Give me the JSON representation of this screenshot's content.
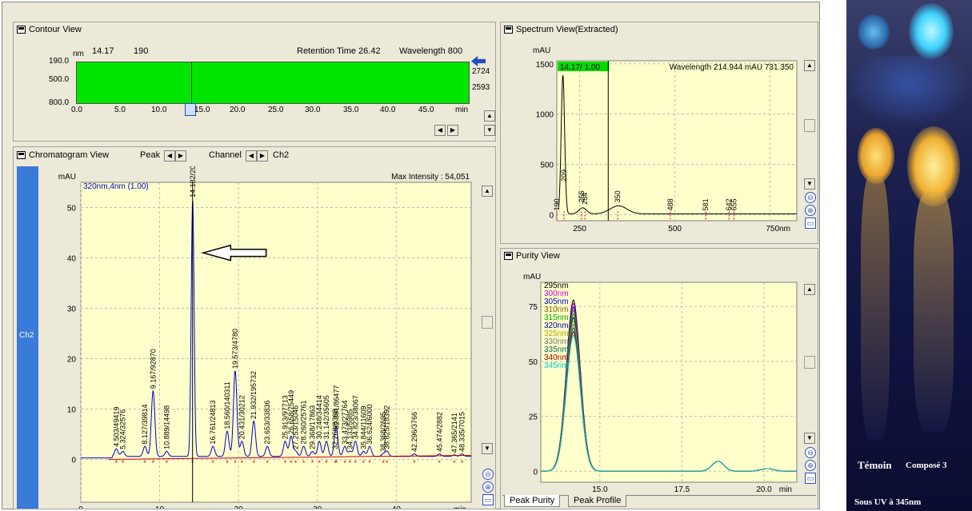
{
  "contour": {
    "title": "Contour View",
    "unit": "nm",
    "cursor_rt": "14.17",
    "cursor_wl": "190",
    "rt_label": "Retention Time 26.42",
    "wl_label": "Wavelength  800",
    "y_ticks": [
      "190.0",
      "500.0",
      "800.0"
    ],
    "x_ticks": [
      "0.0",
      "5.0",
      "10.0",
      "15.0",
      "20.0",
      "25.0",
      "30.0",
      "35.0",
      "40.0",
      "45.0"
    ],
    "x_unit": "min",
    "right_vals": [
      "2724",
      "2593"
    ]
  },
  "chromatogram": {
    "title": "Chromatogram View",
    "peak_label": "Peak",
    "channel_label": "Channel",
    "channel_value": "Ch2",
    "side_label": "Ch2",
    "y_unit": "mAU",
    "trace_label": "320nm,4nm (1.00)",
    "max_intensity": "Max Intensity : 54,051",
    "y_ticks": [
      "50",
      "40",
      "30",
      "20",
      "10",
      "0"
    ],
    "x_ticks": [
      "0",
      "10",
      "20",
      "30",
      "40"
    ],
    "x_unit": "min",
    "peak_labels": [
      "4.503/49419",
      "5.324/32576",
      "8.127/39814",
      "9.167/92870",
      "10.889/14498",
      "14.182/2050641",
      "16.761/24813",
      "18.560/140311",
      "19.573/4780",
      "20.431/30212",
      "21.932/195732",
      "23.653/33836",
      "25.913/97713",
      "26.658/75449",
      "27.253/15046",
      "28.260/25761",
      "29.368/17863",
      "30.248/34414",
      "31.142/35605",
      "32.268/6368",
      "32.391/86477",
      "33.473/27764",
      "34.133/5985",
      "34.823/38067",
      "35.844/11609",
      "36.624/6000",
      "38.368/2695",
      "38.825/18392",
      "42.296/3766",
      "45.474/2882",
      "47.365/2141",
      "48.335/7015"
    ]
  },
  "spectrum": {
    "title": "Spectrum View(Extracted)",
    "y_unit": "mAU",
    "highlight": "14.17/ 1.00",
    "readout": "Wavelength  214.944    mAU  731.350",
    "y_ticks": [
      "1500",
      "1000",
      "500",
      "0"
    ],
    "x_ticks": [
      "250",
      "500",
      "750nm"
    ],
    "peak_labels": [
      "190",
      "209",
      "255",
      "264",
      "350",
      "488",
      "581",
      "642",
      "655"
    ]
  },
  "purity": {
    "title": "Purity View",
    "y_unit": "mAU",
    "wavelengths": [
      "295nm",
      "300nm",
      "305nm",
      "310nm",
      "315nm",
      "320nm",
      "325nm",
      "330nm",
      "335nm",
      "340nm",
      "345nm"
    ],
    "wl_colors": [
      "#000000",
      "#cc00cc",
      "#0000cc",
      "#886600",
      "#00aa00",
      "#0000aa",
      "#aaaa00",
      "#777777",
      "#006666",
      "#990000",
      "#00cccc"
    ],
    "y_ticks": [
      "75",
      "50",
      "25",
      "0"
    ],
    "x_ticks": [
      "15.0",
      "17.5",
      "20.0"
    ],
    "x_unit": "min",
    "tabs": [
      "Peak Purity",
      "Peak Profile"
    ]
  },
  "photo": {
    "label_left": "Témoin",
    "label_right": "Composé 3",
    "caption": "Sous UV à 345nm"
  }
}
